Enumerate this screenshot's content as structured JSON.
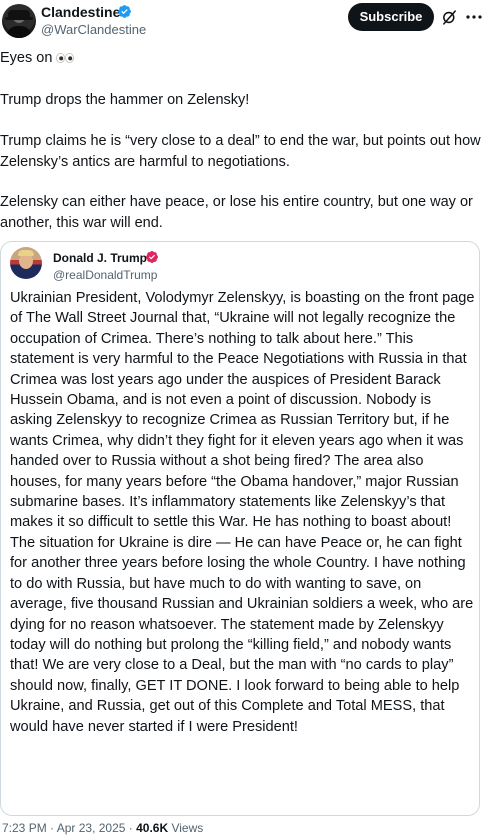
{
  "author": {
    "name": "Clandestine",
    "handle": "@WarClandestine"
  },
  "header": {
    "subscribe_label": "Subscribe"
  },
  "icons": {
    "verified": "verified-badge-icon",
    "grok": "grok-icon",
    "more": "more-options-icon",
    "eyes": "eyes-emoji-icon"
  },
  "colors": {
    "verified_blue": "#1d9bf0",
    "gov_gray": "#829aab",
    "text": "#0f1419",
    "secondary": "#536471"
  },
  "tweet": {
    "line1": "Eyes on ",
    "paragraph2": "Trump drops the hammer on Zelensky!",
    "paragraph3": "Trump claims he is “very close to a deal” to end the war, but points out how Zelensky’s antics are harmful to negotiations.",
    "paragraph4": "Zelensky can either have peace, or lose his entire country, but one way or another, this war will end."
  },
  "quoted": {
    "name": "Donald J. Trump",
    "handle": "@realDonaldTrump",
    "body": "Ukrainian President, Volodymyr Zelenskyy, is boasting on the front page of The Wall Street Journal that, “Ukraine will not legally recognize the occupation of Crimea. There’s nothing to talk about here.” This statement is very harmful to the Peace Negotiations with Russia in that Crimea was lost years ago under the auspices of President Barack Hussein Obama, and is not even a point of discussion. Nobody is asking Zelenskyy to recognize Crimea as Russian Territory but, if he wants Crimea, why didn’t they fight for it eleven years ago when it was handed over to Russia without a shot being fired? The area also houses, for many years before “the Obama handover,” major Russian submarine bases. It’s inflammatory statements like Zelenskyy’s that makes it so difficult to settle this War. He has nothing to boast about! The situation for Ukraine is dire — He can have Peace or, he can fight for another three years before losing the whole Country. I have nothing to do with Russia, but have much to do with wanting to save, on average, five thousand Russian and Ukrainian soldiers a week, who are dying for no reason whatsoever. The statement made by Zelenskyy today will do nothing but prolong the “killing field,” and nobody wants that! We are very close to a Deal, but the man with “no cards to play” should now, finally, GET IT DONE. I look forward to being able to help Ukraine, and Russia, get out of this Complete and Total MESS, that would have never started if I were President!"
  },
  "footer": {
    "time": "7:23 PM",
    "separator": " · ",
    "date": "Apr 23, 2025",
    "views_count": "40.6K",
    "views_label": " Views"
  }
}
